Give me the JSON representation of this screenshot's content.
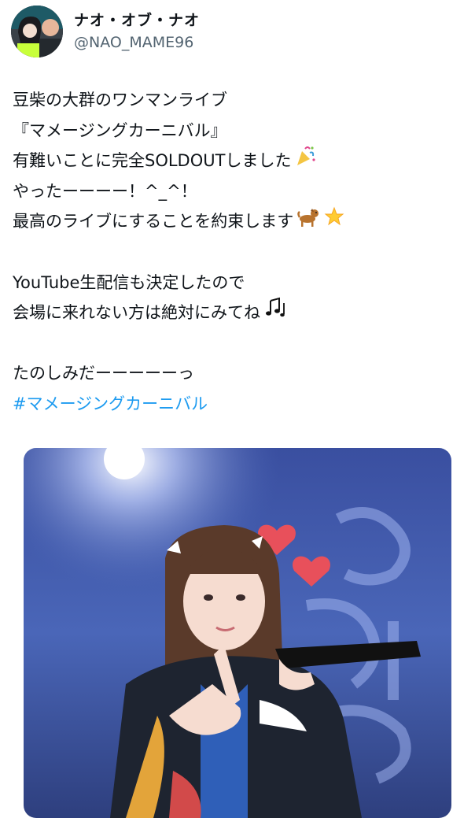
{
  "header": {
    "display_name": "ナオ・オブ・ナオ",
    "handle": "@NAO_MAME96"
  },
  "tweet": {
    "lines": [
      "豆柴の大群のワンマンライブ",
      "『マメージングカーニバル』",
      "有難いことに完全SOLDOUTしました",
      "やったーーーー！^_^！",
      "最高のライブにすることを約束します",
      "",
      "YouTube生配信も決定したので",
      "会場に来れない方は絶対にみてね",
      "",
      "たのしみだーーーーーっ"
    ],
    "hashtag": "#マメージングカーニバル",
    "emojis": {
      "line3": "party-popper-icon",
      "line5a": "dog-icon",
      "line5b": "glowing-star-icon",
      "line8": "music-notes-icon"
    }
  },
  "colors": {
    "text": "#0f1419",
    "secondary": "#536471",
    "link": "#1d9bf0"
  }
}
